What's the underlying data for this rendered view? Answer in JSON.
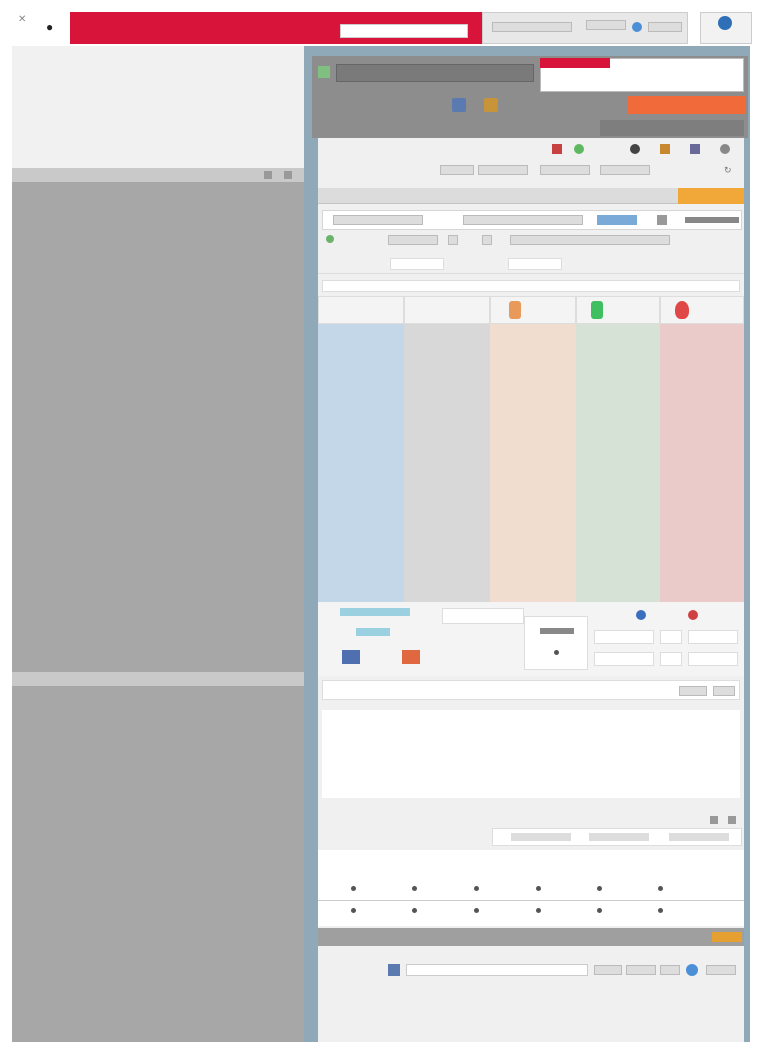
{
  "left_table": {
    "headers": [
      "",
      "",
      "",
      ""
    ],
    "rows": [
      {
        "a": "",
        "b": "",
        "c": "",
        "d": ""
      },
      {
        "a": "",
        "b": "",
        "c": "",
        "d": ""
      },
      {
        "a": "",
        "b": "",
        "c": "",
        "d": ""
      },
      {
        "a": "",
        "b": "",
        "c": "",
        "d": ""
      },
      {
        "a": "",
        "b": "",
        "c": "",
        "d": ""
      }
    ]
  },
  "topbar": {
    "search_placeholder": "",
    "app_title": "",
    "user_label": ""
  },
  "toolbar": {
    "action_label": "",
    "value_label": ""
  },
  "kanban": {
    "columns": [
      {
        "name": "",
        "color": "#c4d7e8"
      },
      {
        "name": "",
        "color": "#d8d8d8"
      },
      {
        "name": "",
        "color": "#f1dcd0"
      },
      {
        "name": "",
        "color": "#d6e2d5"
      },
      {
        "name": "",
        "color": "#ebcaca"
      }
    ]
  },
  "summary_table": {
    "columns": [
      "",
      "",
      "",
      "",
      "",
      ""
    ],
    "rows": [
      {
        "label": "",
        "values": [
          "",
          "",
          "",
          "",
          "",
          ""
        ]
      },
      {
        "label": "",
        "values": [
          "",
          "",
          "",
          "",
          "",
          ""
        ]
      }
    ]
  },
  "colors": {
    "brand_red": "#d8143a",
    "accent_orange": "#f06a3a",
    "chip_orange": "#f2a838",
    "panel_gray": "#a7a7a7"
  }
}
